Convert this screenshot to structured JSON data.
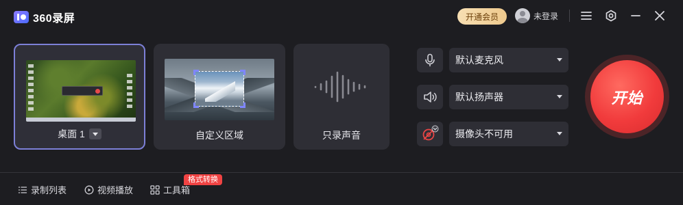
{
  "app": {
    "title": "360录屏"
  },
  "header": {
    "vip_label": "开通会员",
    "user_label": "未登录"
  },
  "modes": [
    {
      "label": "桌面 1",
      "selected": true
    },
    {
      "label": "自定义区域",
      "selected": false
    },
    {
      "label": "只录声音",
      "selected": false
    }
  ],
  "devices": {
    "microphone": {
      "value": "默认麦克风",
      "icon": "microphone-icon"
    },
    "speaker": {
      "value": "默认扬声器",
      "icon": "speaker-icon"
    },
    "camera": {
      "value": "摄像头不可用",
      "icon": "camera-disabled-icon"
    }
  },
  "start": {
    "label": "开始"
  },
  "bottom_nav": [
    {
      "label": "录制列表",
      "icon": "list-icon"
    },
    {
      "label": "视频播放",
      "icon": "play-icon"
    },
    {
      "label": "工具箱",
      "icon": "grid-icon"
    }
  ],
  "badge": {
    "label": "格式转换"
  },
  "colors": {
    "accent": "#7d80d8",
    "start": "#f13b3c",
    "vip": "#eec98d",
    "badge": "#f04343"
  }
}
